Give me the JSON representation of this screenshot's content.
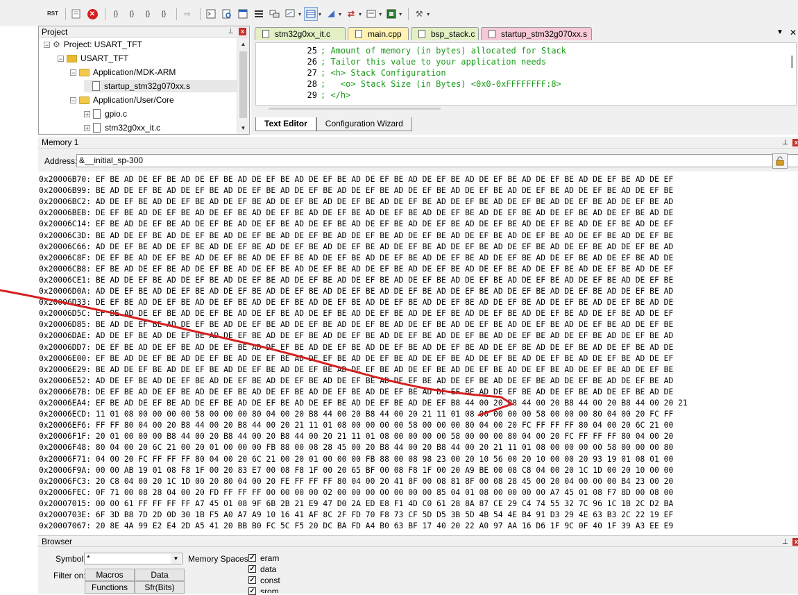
{
  "toolbar": {
    "rst_label": "RST",
    "icons": [
      "reset-icon",
      "window-icon",
      "stop-icon",
      "step-into-icon",
      "step-over-icon",
      "step-out-icon",
      "run-to-cursor-icon",
      "arrow-icon",
      "command-window-icon",
      "disassembly-icon",
      "symbols-icon",
      "registers-icon",
      "call-stack-icon",
      "watch-icon",
      "memory-icon",
      "serial-icon",
      "analysis-icon",
      "trace-icon",
      "system-viewer-icon",
      "toolbox-icon"
    ]
  },
  "project_panel": {
    "title": "Project",
    "pin": "p",
    "close": "x",
    "tree": [
      {
        "label": "Project: USART_TFT",
        "expander": "−"
      },
      {
        "label": "USART_TFT",
        "expander": "−"
      },
      {
        "label": "Application/MDK-ARM",
        "expander": "−"
      },
      {
        "label": "startup_stm32g070xx.s",
        "expander": ""
      },
      {
        "label": "Application/User/Core",
        "expander": "−"
      },
      {
        "label": "gpio.c",
        "expander": "+"
      },
      {
        "label": "stm32g0xx_it.c",
        "expander": "+"
      }
    ]
  },
  "editor": {
    "tabs": [
      {
        "label": "stm32g0xx_it.c"
      },
      {
        "label": "main.cpp"
      },
      {
        "label": "bsp_stack.c"
      },
      {
        "label": "startup_stm32g070xx.s"
      }
    ],
    "menu_arrow": "▼",
    "close": "✕",
    "lines": [
      {
        "num": "25",
        "text": "; Amount of memory (in bytes) allocated for Stack"
      },
      {
        "num": "26",
        "text": "; Tailor this value to your application needs"
      },
      {
        "num": "27",
        "text": "; <h> Stack Configuration"
      },
      {
        "num": "28",
        "text": ";   <o> Stack Size (in Bytes) <0x0-0xFFFFFFFF:8>"
      },
      {
        "num": "29",
        "text": "; </h>"
      }
    ],
    "bottom_tabs": [
      "Text Editor",
      "Configuration Wizard"
    ]
  },
  "memory": {
    "title": "Memory 1",
    "address_label": "Address:",
    "address_value": "&__initial_sp-300",
    "rows": [
      "0x20006B70: EF BE AD DE EF BE AD DE EF BE AD DE EF BE AD DE EF BE AD DE EF BE AD DE EF BE AD DE EF BE AD DE EF BE AD DE EF BE AD DE EF",
      "0x20006B99: BE AD DE EF BE AD DE EF BE AD DE EF BE AD DE EF BE AD DE EF BE AD DE EF BE AD DE EF BE AD DE EF BE AD DE EF BE AD DE EF BE",
      "0x20006BC2: AD DE EF BE AD DE EF BE AD DE EF BE AD DE EF BE AD DE EF BE AD DE EF BE AD DE EF BE AD DE EF BE AD DE EF BE AD DE EF BE AD",
      "0x20006BEB: DE EF BE AD DE EF BE AD DE EF BE AD DE EF BE AD DE EF BE AD DE EF BE AD DE EF BE AD DE EF BE AD DE EF BE AD DE EF BE AD DE",
      "0x20006C14: EF BE AD DE EF BE AD DE EF BE AD DE EF BE AD DE EF BE AD DE EF BE AD DE EF BE AD DE EF BE AD DE EF BE AD DE EF BE AD DE EF",
      "0x20006C3D: BE AD DE EF BE AD DE EF BE AD DE EF BE AD DE EF BE AD DE EF BE AD DE EF BE AD DE EF BE AD DE EF BE AD DE EF BE AD DE EF BE",
      "0x20006C66: AD DE EF BE AD DE EF BE AD DE EF BE AD DE EF BE AD DE EF BE AD DE EF BE AD DE EF BE AD DE EF BE AD DE EF BE AD DE EF BE AD",
      "0x20006C8F: DE EF BE AD DE EF BE AD DE EF BE AD DE EF BE AD DE EF BE AD DE EF BE AD DE EF BE AD DE EF BE AD DE EF BE AD DE EF BE AD DE",
      "0x20006CB8: EF BE AD DE EF BE AD DE EF BE AD DE EF BE AD DE EF BE AD DE EF BE AD DE EF BE AD DE EF BE AD DE EF BE AD DE EF BE AD DE EF",
      "0x20006CE1: BE AD DE EF BE AD DE EF BE AD DE EF BE AD DE EF BE AD DE EF BE AD DE EF BE AD DE EF BE AD DE EF BE AD DE EF BE AD DE EF BE",
      "0x20006D0A: AD DE EF BE AD DE EF BE AD DE EF BE AD DE EF BE AD DE EF BE AD DE EF BE AD DE EF BE AD DE EF BE AD DE EF BE AD DE EF BE AD",
      "0x20006D33: DE EF BE AD DE EF BE AD DE EF BE AD DE EF BE AD DE EF BE AD DE EF BE AD DE EF BE AD DE EF BE AD DE EF BE AD DE EF BE AD DE",
      "0x20006D5C: EF BE AD DE EF BE AD DE EF BE AD DE EF BE AD DE EF BE AD DE EF BE AD DE EF BE AD DE EF BE AD DE EF BE AD DE EF BE AD DE EF",
      "0x20006D85: BE AD DE EF BE AD DE EF BE AD DE EF BE AD DE EF BE AD DE EF BE AD DE EF BE AD DE EF BE AD DE EF BE AD DE EF BE AD DE EF BE",
      "0x20006DAE: AD DE EF BE AD DE EF BE AD DE EF BE AD DE EF BE AD DE EF BE AD DE EF BE AD DE EF BE AD DE EF BE AD DE EF BE AD DE EF BE AD",
      "0x20006DD7: DE EF BE AD DE EF BE AD DE EF BE AD DE EF BE AD DE EF BE AD DE EF BE AD DE EF BE AD DE EF BE AD DE EF BE AD DE EF BE AD DE",
      "0x20006E00: EF BE AD DE EF BE AD DE EF BE AD DE EF BE AD DE EF BE AD DE EF BE AD DE EF BE AD DE EF BE AD DE EF BE AD DE EF BE AD DE EF",
      "0x20006E29: BE AD DE EF BE AD DE EF BE AD DE EF BE AD DE EF BE AD DE EF BE AD DE EF BE AD DE EF BE AD DE EF BE AD DE EF BE AD DE EF BE",
      "0x20006E52: AD DE EF BE AD DE EF BE AD DE EF BE AD DE EF BE AD DE EF BE AD DE EF BE AD DE EF BE AD DE EF BE AD DE EF BE AD DE EF BE AD",
      "0x20006E7B: DE EF BE AD DE EF BE AD DE EF BE AD DE EF BE AD DE EF BE AD DE EF BE AD DE EF BE AD DE EF BE AD DE EF BE AD DE EF BE AD DE",
      "0x20006EA4: EF BE AD DE EF BE AD DE EF BE AD DE EF BE AD DE EF BE AD DE EF BE AD DE EF B8 44 00 20 B8 44 00 20 B8 44 00 20 B8 44 00 20 21",
      "0x20006ECD: 11 01 08 00 00 00 00 58 00 00 00 80 04 00 20 B8 44 00 20 B8 44 00 20 21 11 01 08 00 00 00 00 58 00 00 00 80 04 00 20 FC FF",
      "0x20006EF6: FF FF 80 04 00 20 B8 44 00 20 B8 44 00 20 21 11 01 08 00 00 00 00 58 00 00 00 80 04 00 20 FC FF FF FF 80 04 00 20 6C 21 00",
      "0x20006F1F: 20 01 00 00 00 B8 44 00 20 B8 44 00 20 B8 44 00 20 21 11 01 08 00 00 00 00 58 00 00 00 80 04 00 20 FC FF FF FF 80 04 00 20",
      "0x20006F48: 80 04 00 20 6C 21 00 20 01 00 00 00 FB 88 00 08 28 45 00 20 B8 44 00 20 B8 44 00 20 21 11 01 08 00 00 00 00 58 00 00 00 80",
      "0x20006F71: 04 00 20 FC FF FF FF 80 04 00 20 6C 21 00 20 01 00 00 00 FB 88 00 08 98 23 00 20 10 56 00 20 10 00 00 20 93 19 01 08 01 00",
      "0x20006F9A: 00 00 AB 19 01 08 F8 1F 00 20 83 E7 00 08 F8 1F 00 20 65 BF 00 08 F8 1F 00 20 A9 BE 00 08 C8 04 00 20 1C 1D 00 20 10 00 00",
      "0x20006FC3: 20 C8 04 00 20 1C 1D 00 20 80 04 00 20 FE FF FF FF 80 04 00 20 41 8F 00 08 81 8F 00 08 28 45 00 20 04 00 00 00 B4 23 00 20",
      "0x20006FEC: 0F 71 00 08 28 04 00 20 FD FF FF FF 00 00 00 00 02 00 00 00 00 00 00 00 85 04 01 08 00 00 00 00 A7 45 01 08 F7 8D 00 08 00",
      "0x20007015: 00 00 61 FF FF FF FF A7 45 01 08 9F 6B 2B 21 E9 47 D0 2A ED E8 F1 4D C0 61 28 8A 87 CE 29 C4 74 55 32 7C 96 1C 1B 2C D2 BA",
      "0x2000703E: 6F 3D B8 7D 2D 0D 30 1B F5 A0 A7 A9 10 16 41 AF 8C 2F FD 70 F8 73 CF 5D D5 3B 5D 4B 54 4E B4 91 D3 29 4E 63 B3 2C 22 19 EF",
      "0x20007067: 20 8E 4A 99 E2 E4 2D A5 41 20 BB B0 FC 5C F5 20 DC BA FD A4 B0 63 BF 17 40 20 22 A0 97 AA 16 D6 1F 9C 0F 40 1F 39 A3 EE E9"
    ]
  },
  "browser": {
    "title": "Browser",
    "symbol_label": "Symbol:",
    "symbol_value": "*",
    "memory_spaces_label": "Memory Spaces:",
    "filter_label": "Filter on:",
    "buttons": [
      "Macros",
      "Data",
      "Functions",
      "Sfr(Bits)"
    ],
    "spaces": [
      {
        "label": "eram",
        "checked": true
      },
      {
        "label": "data",
        "checked": true
      },
      {
        "label": "const",
        "checked": true
      },
      {
        "label": "srom",
        "checked": true
      }
    ]
  },
  "colors": {
    "annotation": "#d62020",
    "comment": "#1a9a1a",
    "active_tab": "#f7c9d6",
    "main_tab": "#fff2b3",
    "file_tab": "#e3efc4"
  }
}
